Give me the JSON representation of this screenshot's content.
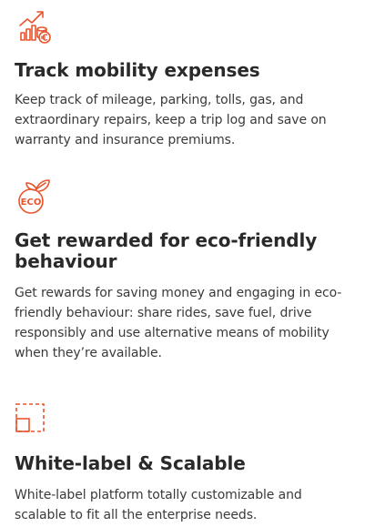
{
  "accent_color": "#e8542c",
  "features": [
    {
      "icon": "chart-coins-icon",
      "title": "Track mobility expenses",
      "text": "Keep track of mileage, parking, tolls, gas, and extraordinary repairs, keep a trip log and save on warranty and insurance premiums."
    },
    {
      "icon": "eco-leaf-icon",
      "icon_label": "ECO",
      "title": "Get rewarded for eco-friendly behaviour",
      "text": "Get rewards for saving money and engaging in eco-friendly behaviour: share rides, save fuel, drive responsibly and use alternative means of mobility when they’re available."
    },
    {
      "icon": "scalable-square-icon",
      "title": "White-label & Scalable",
      "text": "White-label platform totally customizable and scalable to fit all the enterprise needs."
    }
  ]
}
